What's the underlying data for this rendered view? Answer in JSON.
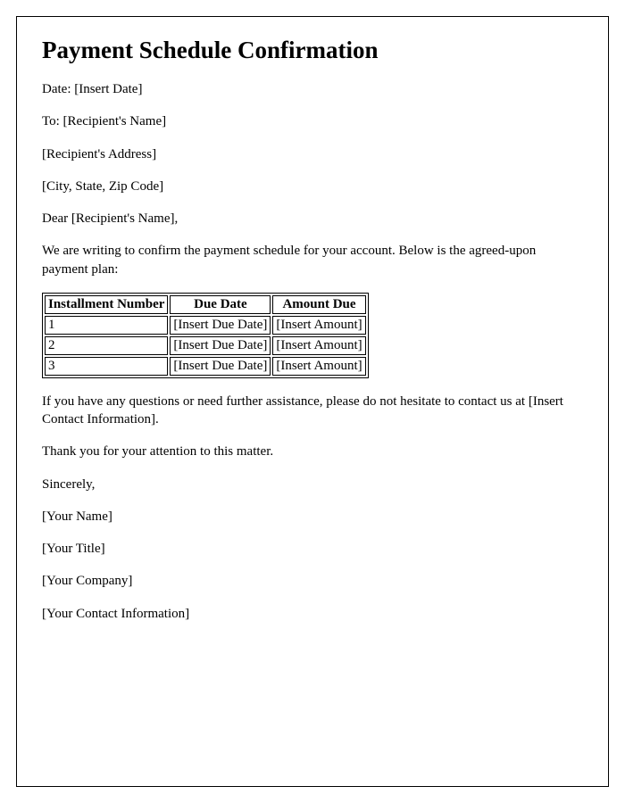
{
  "title": "Payment Schedule Confirmation",
  "header": {
    "date_line": "Date: [Insert Date]",
    "to_line": "To: [Recipient's Name]",
    "address_line": "[Recipient's Address]",
    "city_line": "[City, State, Zip Code]"
  },
  "salutation": "Dear [Recipient's Name],",
  "intro": "We are writing to confirm the payment schedule for your account. Below is the agreed-upon payment plan:",
  "table": {
    "headers": {
      "col1": "Installment Number",
      "col2": "Due Date",
      "col3": "Amount Due"
    },
    "rows": [
      {
        "number": "1",
        "due_date": "[Insert Due Date]",
        "amount": "[Insert Amount]"
      },
      {
        "number": "2",
        "due_date": "[Insert Due Date]",
        "amount": "[Insert Amount]"
      },
      {
        "number": "3",
        "due_date": "[Insert Due Date]",
        "amount": "[Insert Amount]"
      }
    ]
  },
  "assistance": "If you have any questions or need further assistance, please do not hesitate to contact us at [Insert Contact Information].",
  "thanks": "Thank you for your attention to this matter.",
  "closing": "Sincerely,",
  "signature": {
    "name": "[Your Name]",
    "title": "[Your Title]",
    "company": "[Your Company]",
    "contact": "[Your Contact Information]"
  }
}
